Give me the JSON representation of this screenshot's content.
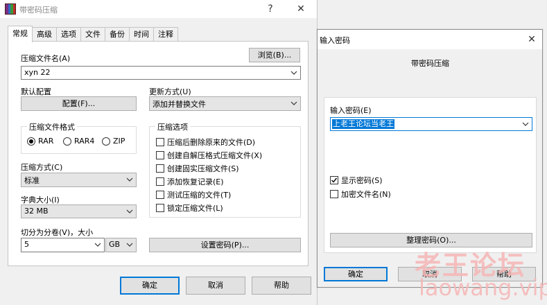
{
  "main_window": {
    "title": "带密码压缩",
    "help_glyph": "?",
    "close_glyph": "✕",
    "tabs": [
      "常规",
      "高级",
      "选项",
      "文件",
      "备份",
      "时间",
      "注释"
    ],
    "archive_name_label": "压缩文件名(A)",
    "browse_button": "浏览(B)...",
    "archive_name_value": "xyn 22",
    "default_profile_label": "默认配置",
    "profiles_button": "配置(F)...",
    "update_mode_label": "更新方式(U)",
    "update_mode_value": "添加并替换文件",
    "archive_format_label": "压缩文件格式",
    "formats": [
      {
        "label": "RAR",
        "selected": true
      },
      {
        "label": "RAR4",
        "selected": false
      },
      {
        "label": "ZIP",
        "selected": false
      }
    ],
    "options_group_label": "压缩选项",
    "options": [
      {
        "label": "压缩后删除原来的文件(D)",
        "checked": false
      },
      {
        "label": "创建自解压格式压缩文件(X)",
        "checked": false
      },
      {
        "label": "创建固实压缩文件(S)",
        "checked": false
      },
      {
        "label": "添加恢复记录(E)",
        "checked": false
      },
      {
        "label": "测试压缩的文件(T)",
        "checked": false
      },
      {
        "label": "锁定压缩文件(L)",
        "checked": false
      }
    ],
    "compression_method_label": "压缩方式(C)",
    "compression_method_value": "标准",
    "dictionary_size_label": "字典大小(I)",
    "dictionary_size_value": "32 MB",
    "split_label": "切分为分卷(V)，大小",
    "split_value": "5",
    "split_unit_value": "GB",
    "set_password_button": "设置密码(P)...",
    "ok_button": "确定",
    "cancel_button": "取消",
    "help_button": "帮助"
  },
  "password_dialog": {
    "title": "输入密码",
    "close_glyph": "✕",
    "heading": "带密码压缩",
    "password_label": "输入密码(E)",
    "password_value": "上老王论坛当老王",
    "show_password_label": "显示密码(S)",
    "show_password_checked": true,
    "encrypt_names_label": "加密文件名(N)",
    "encrypt_names_checked": false,
    "organize_button": "整理密码(O)...",
    "ok_button": "确定",
    "cancel_button": "取消",
    "help_button": "帮助"
  },
  "watermark": {
    "line1": "老王论坛",
    "line2": "laowang.vip"
  },
  "colors": {
    "accent": "#0078d7",
    "window_bg": "#f0f0f0",
    "panel_bg": "#ffffff",
    "watermark": "#f7b6b6"
  }
}
